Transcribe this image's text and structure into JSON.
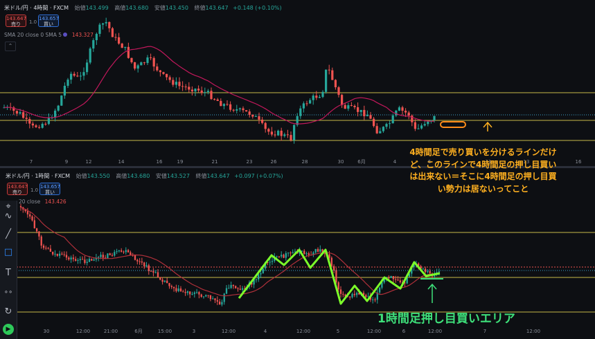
{
  "colors": {
    "up": "#26a69a",
    "down": "#ef5350",
    "sma20": "#c2185b",
    "sma5": "#b0303a",
    "level": "#c8b94a",
    "dotted": "#3aa0c8",
    "annotation_orange": "#ffb020",
    "annotation_green": "#3ee07a",
    "zigzag": "#7cff2a"
  },
  "top_chart": {
    "symbol": "米ドル/円 · 4時間 · FXCM",
    "open_label": "始値",
    "open": "143.499",
    "high_label": "高値",
    "high": "143.680",
    "low_label": "安値",
    "low": "143.450",
    "close_label": "終値",
    "close": "143.647",
    "change": "+0.148 (+0.10%)",
    "sell_price": "143.647",
    "sell_label": "売り",
    "spread": "1.0",
    "buy_price": "143.657",
    "buy_label": "買い",
    "indicator": "SMA 20 close 0 SMA 5",
    "indicator_value": "143.327",
    "collapse_icon": "chevron-up-icon",
    "x_ticks": [
      "7",
      "9",
      "12",
      "14",
      "16",
      "19",
      "21",
      "23",
      "26",
      "28",
      "30",
      "6月",
      "4",
      "6",
      "11",
      "13",
      "16"
    ]
  },
  "bottom_chart": {
    "symbol": "米ドル/円 · 1時間 · FXCM",
    "open_label": "始値",
    "open": "143.550",
    "high_label": "高値",
    "high": "143.680",
    "low_label": "安値",
    "low": "143.527",
    "close_label": "終値",
    "close": "143.647",
    "change": "+0.097 (+0.07%)",
    "sell_price": "143.647",
    "sell_label": "売り",
    "spread": "1.0",
    "buy_price": "143.657",
    "buy_label": "買い",
    "indicator": "20 close",
    "indicator_value": "143.426",
    "x_ticks": [
      "30",
      "12:00",
      "21:00",
      "6月",
      "15:00",
      "3",
      "12:00",
      "4",
      "12:00",
      "5",
      "12:00",
      "6",
      "12:00",
      "7",
      "12:00"
    ]
  },
  "toolbar": [
    {
      "icon": "crosshair-icon",
      "glyph": "⌖"
    },
    {
      "icon": "brush-icon",
      "glyph": "∿"
    },
    {
      "icon": "trend-line-icon",
      "glyph": "╱"
    },
    {
      "icon": "rectangle-icon",
      "glyph": "□"
    },
    {
      "icon": "text-tool-icon",
      "glyph": "T"
    },
    {
      "icon": "pattern-icon",
      "glyph": "∘∘"
    },
    {
      "icon": "replay-icon",
      "glyph": "↻"
    },
    {
      "icon": "play-icon",
      "glyph": "▶"
    }
  ],
  "annotations": {
    "top_note": "4時間足で売り買いを分けるラインだけど、このラインで4時間足の押し目買いは出来ない＝そこに4時間足の押し目買い勢力は居ないってこと",
    "bottom_note": "1時間足押し目買いエリア"
  },
  "chart_data": [
    {
      "type": "candlestick",
      "title": "米ドル/円 · 4時間 · FXCM",
      "x_tick_labels": [
        "7",
        "9",
        "12",
        "14",
        "16",
        "19",
        "21",
        "23",
        "26",
        "28",
        "30",
        "6月",
        "4",
        "6",
        "11",
        "13",
        "16"
      ],
      "series": [
        {
          "name": "SMA 20 close 0 SMA 5",
          "last_value": 143.327
        }
      ],
      "horizontal_levels": [
        "upper",
        "middle",
        "lower"
      ],
      "grid": false
    },
    {
      "type": "candlestick",
      "title": "米ドル/円 · 1時間 · FXCM",
      "x_tick_labels": [
        "30",
        "12:00",
        "21:00",
        "6月",
        "15:00",
        "3",
        "12:00",
        "4",
        "12:00",
        "5",
        "12:00",
        "6",
        "12:00",
        "7",
        "12:00"
      ],
      "series": [
        {
          "name": "20 close",
          "last_value": 143.426
        }
      ],
      "horizontal_levels": [
        "upper",
        "middle",
        "lower"
      ],
      "grid": false
    }
  ]
}
